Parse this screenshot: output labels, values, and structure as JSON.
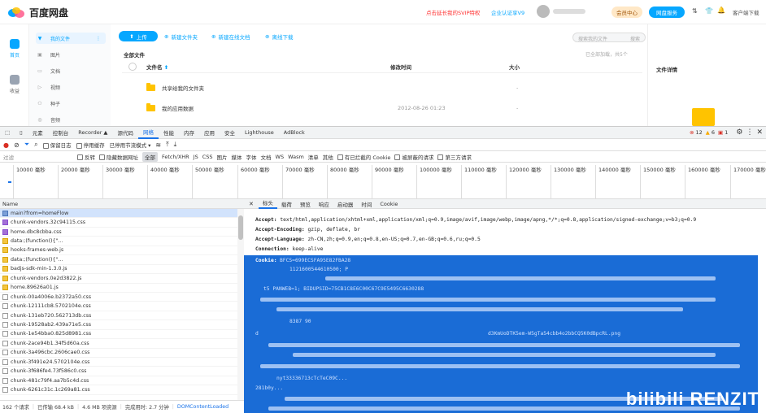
{
  "app": {
    "logo_text": "百度网盘"
  },
  "topbar": {
    "promo": "点击延长我的SVIP特权",
    "enterprise": "企业认证享V9",
    "vip_center": "会员中心",
    "member_btn": "网盘服务",
    "client_label": "客户端下载"
  },
  "rail": {
    "items": [
      "首页",
      "收益"
    ]
  },
  "sidebar": {
    "title": "我的文件",
    "items": [
      "图片",
      "文档",
      "视频",
      "种子",
      "音频"
    ]
  },
  "toolbar": {
    "upload": "上传",
    "new_folder": "新建文件夹",
    "new_online_doc": "新建在线文档",
    "offline": "离线下载",
    "search_placeholder": "搜索我的文件",
    "search_btn": "搜索"
  },
  "files": {
    "section": "全部文件",
    "loaded": "已全部加载，共5个",
    "col_name": "文件名",
    "col_modified": "修改时间",
    "col_size": "大小",
    "rows": [
      {
        "name": "共享给我的文件夹",
        "modified": "",
        "size": "-"
      },
      {
        "name": "我的应用数据",
        "modified": "2012-08-26 01:23",
        "size": "-"
      }
    ]
  },
  "detail": {
    "title": "文件详情"
  },
  "devtools": {
    "tabs": [
      "元素",
      "控制台",
      "Recorder ▲",
      "源代码",
      "网络",
      "性能",
      "内存",
      "应用",
      "安全",
      "Lighthouse",
      "AdBlock"
    ],
    "active_tab": "网络",
    "badges": {
      "errors": "12",
      "warnings": "6",
      "issues": "1"
    },
    "toolbar": {
      "preserve_log": "保留日志",
      "disable_cache": "停用缓存",
      "throttle": "已停用节流模式"
    },
    "filter": {
      "placeholder": "过滤",
      "invert": "反转",
      "hide_data": "隐藏数据网址",
      "types": [
        "全部",
        "Fetch/XHR",
        "JS",
        "CSS",
        "图片",
        "媒体",
        "字体",
        "文档",
        "WS",
        "Wasm",
        "清单",
        "其他"
      ],
      "blocked_cookies": "有已拦截的 Cookie",
      "blocked_requests": "被屏蔽的请求",
      "third_party": "第三方请求"
    },
    "timeline": [
      "10000 毫秒",
      "20000 毫秒",
      "30000 毫秒",
      "40000 毫秒",
      "50000 毫秒",
      "60000 毫秒",
      "70000 毫秒",
      "80000 毫秒",
      "90000 毫秒",
      "100000 毫秒",
      "110000 毫秒",
      "120000 毫秒",
      "130000 毫秒",
      "140000 毫秒",
      "150000 毫秒",
      "160000 毫秒",
      "170000 毫秒"
    ],
    "list_header": "Name",
    "requests": [
      "main?from=homeFlow",
      "chunk-vendors.32c94115.css",
      "home.dbc8cbba.css",
      "data:;(function(){\"...",
      "hooks-frames-web.js",
      "data:;(function(){\"...",
      "badjs-sdk-min-1.3.0.js",
      "chunk-vendors.0e2d3822.js",
      "home.89626a01.js",
      "chunk-00a4006e.b2372a50.css",
      "chunk-12111cb8.5702104e.css",
      "chunk-131eb720.562713db.css",
      "chunk-19528ab2.439a71e5.css",
      "chunk-1e54bba0.825d8981.css",
      "chunk-2ace94b1.34f5d60a.css",
      "chunk-3a496cbc.2606cae0.css",
      "chunk-3f491e24.5702104e.css",
      "chunk-3f686fe4.73f586c0.css",
      "chunk-481c79f4.aa7b5c4d.css",
      "chunk-6261c31c.1c269a81.css"
    ],
    "status": {
      "requests": "162 个请求",
      "transferred": "已传输 68.4 kB",
      "resources": "4.6 MB 项资源",
      "finish": "完成用时: 2.7 分钟",
      "dcl": "DOMContentLoaded"
    },
    "detail_tabs": [
      "标头",
      "载荷",
      "预览",
      "响应",
      "启动器",
      "时间",
      "Cookie"
    ],
    "headers": [
      {
        "k": "Accept:",
        "v": " text/html,application/xhtml+xml,application/xml;q=0.9,image/avif,image/webp,image/apng,*/*;q=0.8,application/signed-exchange;v=b3;q=0.9"
      },
      {
        "k": "Accept-Encoding:",
        "v": " gzip, deflate, br"
      },
      {
        "k": "Accept-Language:",
        "v": " zh-CN,zh;q=0.9,en;q=0.8,en-US;q=0.7,en-GB;q=0.6,ru;q=0.5"
      },
      {
        "k": "Connection:",
        "v": " keep-alive"
      }
    ],
    "cookie_label": "Cookie:",
    "cookie_fragments": [
      "BFCS=699ECSFA95E82FBA28",
      "1121600544610500; P",
      "t5 PANWEB=1; BIDUPSID=75CB1C8E6C00C67C9E5495C6630288",
      "8387 90",
      "d",
      "nyt33336713cTcTeC09C...",
      "281b0y...",
      "d3KmUoDTK5em-W5gTa54cbb4o2bbCQ5K0dBpcRL.png"
    ]
  },
  "watermark": "bilibili RENZIT"
}
